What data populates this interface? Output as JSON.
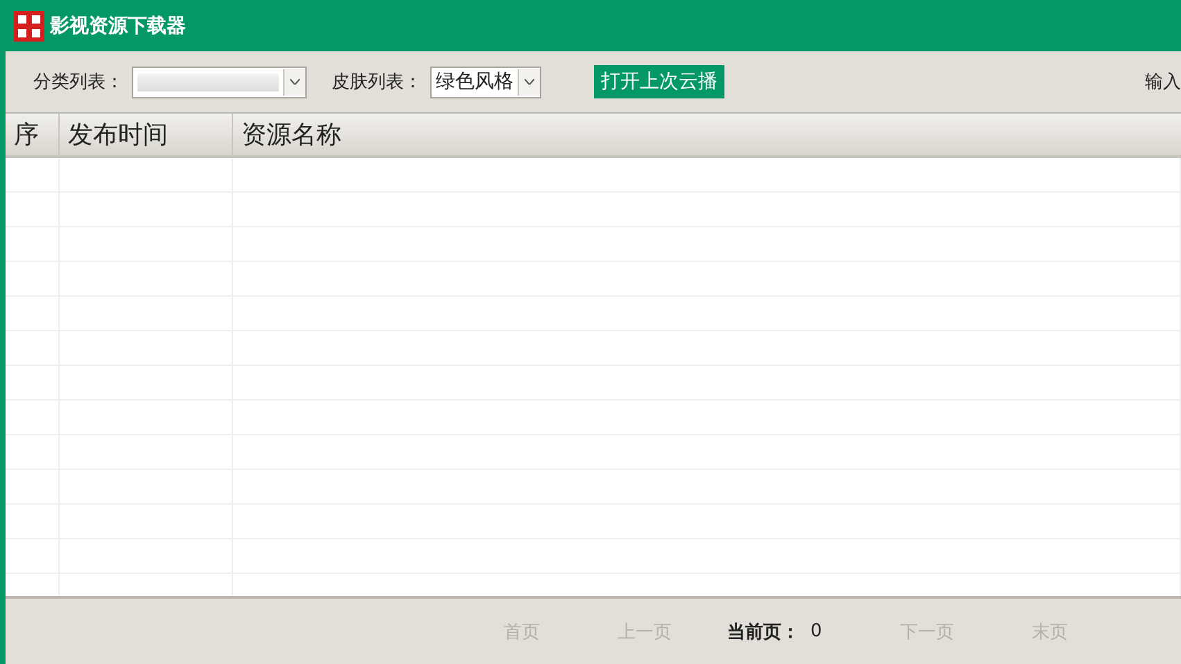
{
  "window": {
    "title": "影视资源下载器"
  },
  "toolbar": {
    "category_label": "分类列表：",
    "skin_label": "皮肤列表：",
    "skin_value": "绿色风格",
    "open_button": "打开上次云播",
    "search_label": "输入"
  },
  "table": {
    "columns": [
      "序",
      "发布时间",
      "资源名称"
    ]
  },
  "pager": {
    "buttons": [
      {
        "label": "首页",
        "disabled": true
      },
      {
        "label": "上一页",
        "disabled": true
      }
    ],
    "current_label": "当前页：",
    "current_value": "0",
    "buttons_after": [
      {
        "label": "下一页",
        "disabled": true
      },
      {
        "label": "末页",
        "disabled": true
      }
    ]
  }
}
